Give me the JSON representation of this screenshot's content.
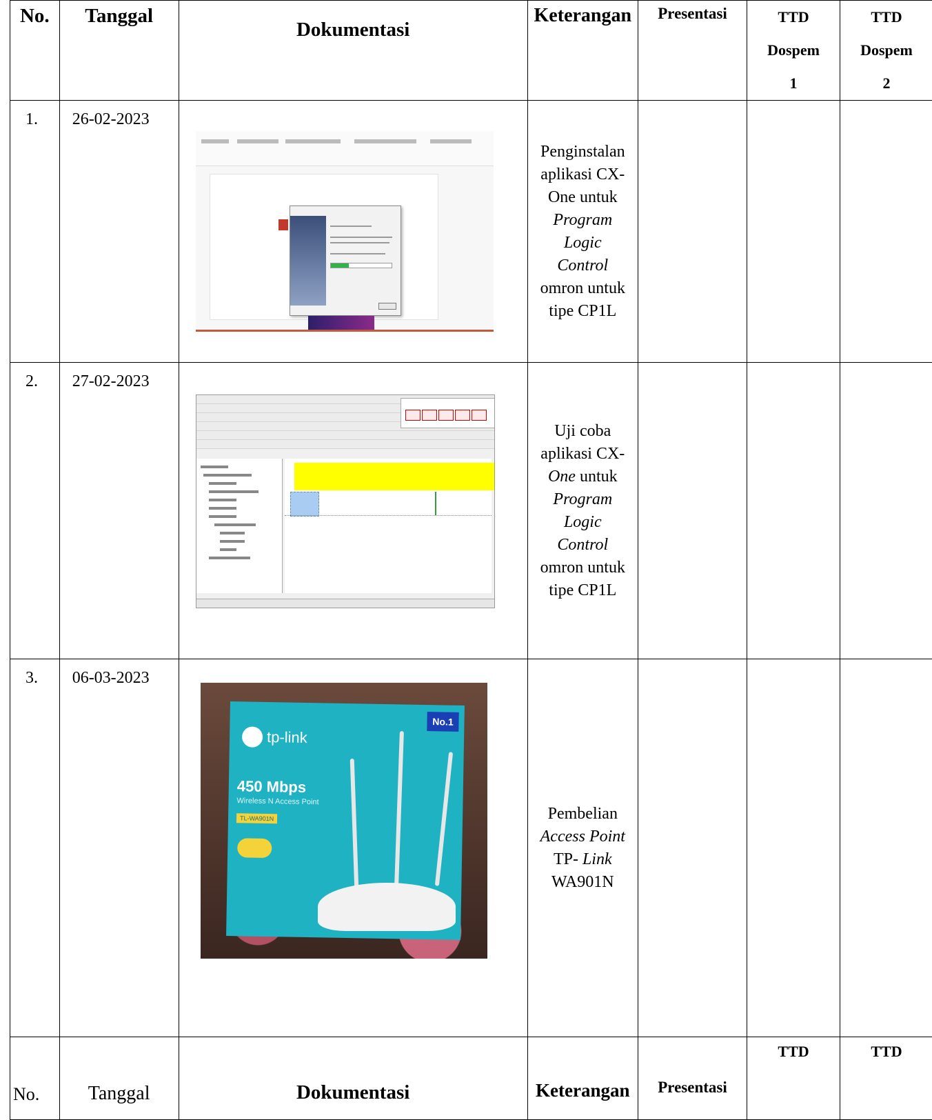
{
  "headers": {
    "no": "No.",
    "tanggal": "Tanggal",
    "dokumentasi": "Dokumentasi",
    "keterangan": "Keterangan",
    "presentasi": "Presentasi",
    "ttd1": [
      "TTD",
      "Dospem",
      "1"
    ],
    "ttd2": [
      "TTD",
      "Dospem",
      "2"
    ]
  },
  "rows": [
    {
      "no": "1.",
      "date": "26-02-2023",
      "ket": [
        {
          "text": "Penginstalan",
          "italic": false
        },
        {
          "text": "aplikasi CX-",
          "italic": false
        },
        {
          "text": "One untuk",
          "italic": false
        },
        {
          "text": "Program",
          "italic": true
        },
        {
          "text": "Logic",
          "italic": true
        },
        {
          "text": "Control",
          "italic": true
        },
        {
          "text": "omron untuk",
          "italic": false
        },
        {
          "text": "tipe CP1L",
          "italic": false
        }
      ]
    },
    {
      "no": "2.",
      "date": "27-02-2023",
      "ket": [
        {
          "text": "Uji coba",
          "italic": false
        },
        {
          "text": "aplikasi CX-",
          "italic": false
        },
        {
          "text": "One",
          "italic": true,
          "tail": " untuk"
        },
        {
          "text": "Program",
          "italic": true
        },
        {
          "text": "Logic",
          "italic": true
        },
        {
          "text": "Control",
          "italic": true
        },
        {
          "text": "omron untuk",
          "italic": false
        },
        {
          "text": "tipe CP1L",
          "italic": false
        }
      ]
    },
    {
      "no": "3.",
      "date": "06-03-2023",
      "ket": [
        {
          "text": "Pembelian",
          "italic": false
        },
        {
          "text": "Access Point",
          "italic": true
        },
        {
          "text": "TP- ",
          "italic": false,
          "tailItalic": "Link"
        },
        {
          "text": "WA901N",
          "italic": false
        }
      ]
    }
  ],
  "photo": {
    "brand": "tp-link",
    "speed": "450 Mbps",
    "subtitle": "Wireless N Access Point",
    "model": "TL-WA901N",
    "badge": "No.1"
  },
  "footer": {
    "no": "No.",
    "tanggal": "Tanggal",
    "dokumentasi": "Dokumentasi",
    "keterangan": "Keterangan",
    "presentasi": "Presentasi",
    "ttd1": "TTD",
    "ttd2": "TTD"
  }
}
